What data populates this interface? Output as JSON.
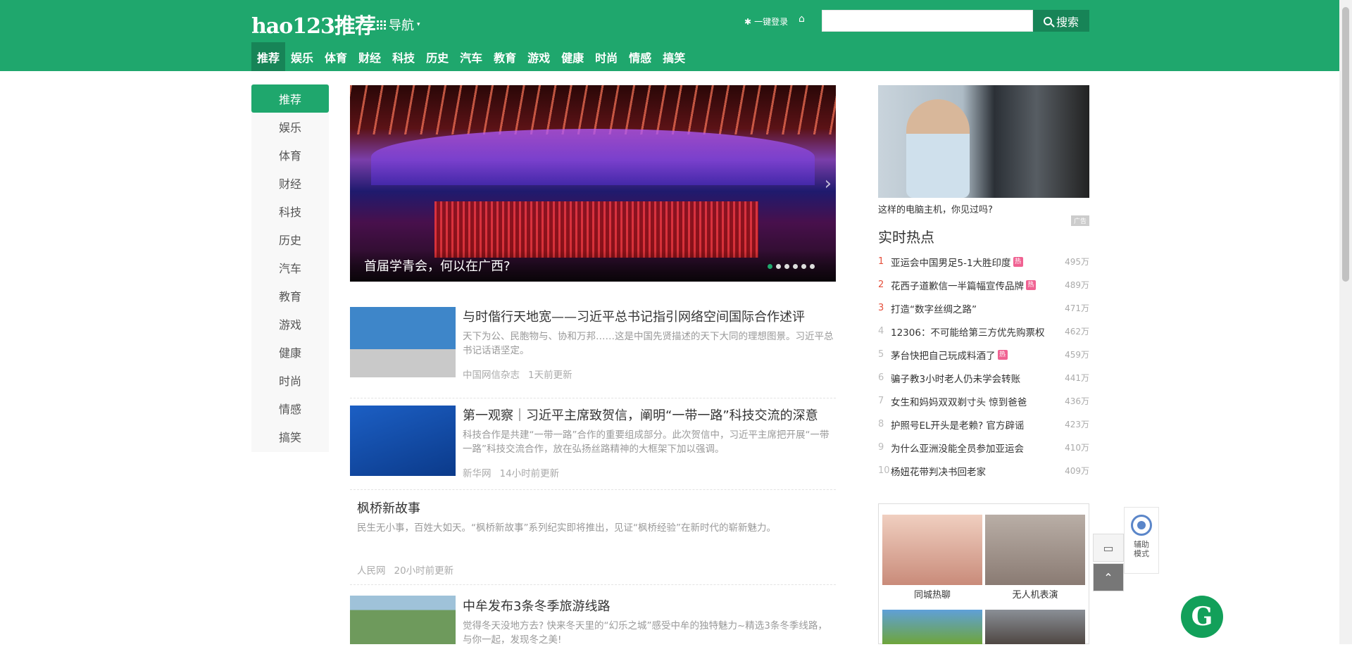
{
  "header": {
    "logo": "hao123推荐",
    "nav_label": "导航",
    "login_label": "一键登录",
    "search": {
      "placeholder": "",
      "button_label": "搜索"
    }
  },
  "categories": [
    "推荐",
    "娱乐",
    "体育",
    "财经",
    "科技",
    "历史",
    "汽车",
    "教育",
    "游戏",
    "健康",
    "时尚",
    "情感",
    "搞笑"
  ],
  "sidebar": [
    "推荐",
    "娱乐",
    "体育",
    "财经",
    "科技",
    "历史",
    "汽车",
    "教育",
    "游戏",
    "健康",
    "时尚",
    "情感",
    "搞笑"
  ],
  "carousel": {
    "caption": "首届学青会，何以在广西?",
    "dot_count": 6,
    "active_dot": 0
  },
  "feed": [
    {
      "title": "与时偕行天地宽——习近平总书记指引网络空间国际合作述评",
      "desc": "天下为公、民胞物与、协和万邦……这是中国先贤描述的天下大同的理想图景。习近平总书记话语坚定。",
      "source": "中国网信杂志",
      "time": "1天前更新"
    },
    {
      "title": "第一观察｜习近平主席致贺信，阐明“一带一路”科技交流的深意",
      "desc": "科技合作是共建“一带一路”合作的重要组成部分。此次贺信中，习近平主席把开展“一带一路”科技交流合作，放在弘扬丝路精神的大框架下加以强调。",
      "source": "新华网",
      "time": "14小时前更新"
    },
    {
      "title": "枫桥新故事",
      "desc": "民生无小事，百姓大如天。“枫桥新故事”系列纪实即将推出，见证“枫桥经验”在新时代的崭新魅力。",
      "source": "人民网",
      "time": "20小时前更新"
    },
    {
      "title": "中牟发布3条冬季旅游线路",
      "desc": "觉得冬天没地方去? 快来冬天里的“幻乐之城”感受中牟的独特魅力~精选3条冬季线路，与你一起，发现冬之美!",
      "source": "",
      "time": ""
    }
  ],
  "right_ad": {
    "caption": "这样的电脑主机，你见过吗?",
    "tag": "广告"
  },
  "hot": {
    "title": "实时热点",
    "items": [
      {
        "rank": "1",
        "text": "亚运会中国男足5-1大胜印度",
        "badge": "热",
        "count": "495万"
      },
      {
        "rank": "2",
        "text": "花西子道歉信一半篇幅宣传品牌",
        "badge": "热",
        "count": "489万"
      },
      {
        "rank": "3",
        "text": "打造“数字丝绸之路”",
        "badge": "",
        "count": "471万"
      },
      {
        "rank": "4",
        "text": "12306：不可能给第三方优先购票权",
        "badge": "",
        "count": "462万"
      },
      {
        "rank": "5",
        "text": "茅台快把自己玩成料酒了",
        "badge": "热",
        "count": "459万"
      },
      {
        "rank": "6",
        "text": "骗子教3小时老人仍未学会转账",
        "badge": "",
        "count": "441万"
      },
      {
        "rank": "7",
        "text": "女生和妈妈双双剃寸头 惊到爸爸",
        "badge": "",
        "count": "436万"
      },
      {
        "rank": "8",
        "text": "护照号EL开头是老赖? 官方辟谣",
        "badge": "",
        "count": "423万"
      },
      {
        "rank": "9",
        "text": "为什么亚洲没能全员参加亚运会",
        "badge": "",
        "count": "410万"
      },
      {
        "rank": "10",
        "text": "杨妞花带判决书回老家",
        "badge": "",
        "count": "409万"
      }
    ]
  },
  "rec": [
    {
      "label": "同城热聊"
    },
    {
      "label": "无人机表演"
    },
    {
      "label": ""
    },
    {
      "label": ""
    }
  ],
  "assist": {
    "label": "辅助模式"
  },
  "colors": {
    "brand": "#1fa76d",
    "brand_dark": "#178457",
    "hot_badge": "#f06292",
    "rank_top": "#e5503c"
  },
  "icons": [
    "grid-icon",
    "home-icon",
    "search-icon",
    "chevron-right-icon",
    "message-icon",
    "back-to-top-icon",
    "accessibility-icon",
    "brand-badge-icon"
  ]
}
